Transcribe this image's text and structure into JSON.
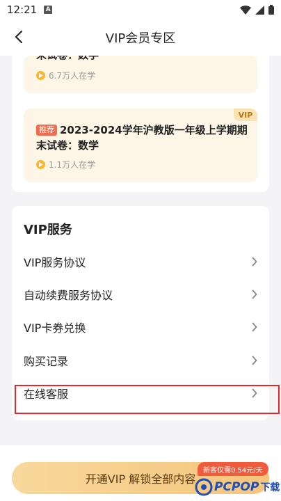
{
  "status": {
    "time": "12:21",
    "notification_letter": "A"
  },
  "nav": {
    "title": "VIP会员专区"
  },
  "courses": [
    {
      "title": "末试卷：数学",
      "learners": "6.7万人在学"
    },
    {
      "tag": "推荐",
      "title": "2023-2024学年沪教版一年级上学期期末试卷：数学",
      "learners": "1.1万人在学",
      "badge": "VIP"
    }
  ],
  "services": {
    "header": "VIP服务",
    "items": [
      {
        "label": "VIP服务协议"
      },
      {
        "label": "自动续费服务协议"
      },
      {
        "label": "VIP卡券兑换"
      },
      {
        "label": "购买记录"
      },
      {
        "label": "在线客服"
      }
    ]
  },
  "bottom": {
    "button_label": "开通VIP 解锁全部内容",
    "promo": "新客仅需0.54元/天"
  },
  "watermark": {
    "brand": "PCPOP",
    "suffix": "下载"
  },
  "colors": {
    "accent": "#f5c57b",
    "tag": "#f26b4c",
    "highlight": "#e8262e"
  }
}
